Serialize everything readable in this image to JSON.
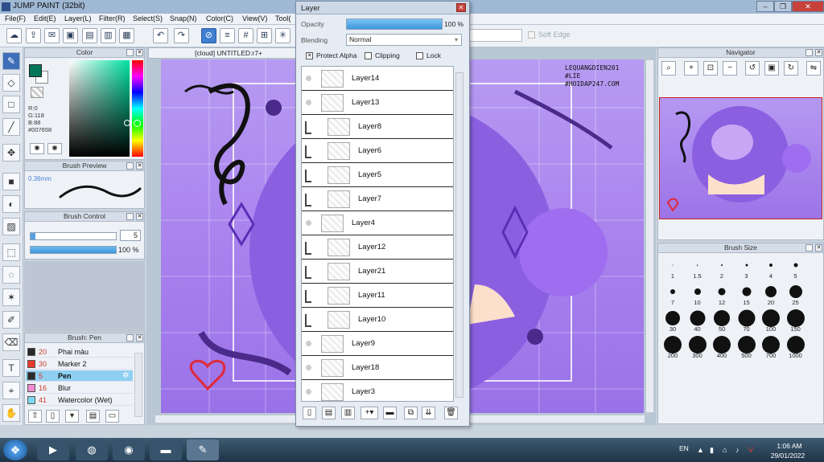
{
  "window": {
    "title": "JUMP PAINT (32bit)",
    "min": "–",
    "max": "❐",
    "close": "✕"
  },
  "menu": [
    "File(F)",
    "Edit(E)",
    "Layer(L)",
    "Filter(R)",
    "Select(S)",
    "Snap(N)",
    "Color(C)",
    "View(V)",
    "Tool("
  ],
  "toolbar": {
    "soft_edge": "Soft Edge"
  },
  "color_panel": {
    "title": "Color",
    "r": "R:0",
    "g": "G:118",
    "b": "B:88",
    "hex": "#007658",
    "main_color": "#007658"
  },
  "brush_preview": {
    "title": "Brush Preview",
    "size": "0.36mm"
  },
  "brush_control": {
    "title": "Brush Control",
    "size": "5",
    "opacity": "100 %"
  },
  "brush_list": {
    "title": "Brush: Pen",
    "items": [
      {
        "num": "20",
        "name": "Phai màu",
        "color": "#2a2a2a"
      },
      {
        "num": "30",
        "name": "Marker 2",
        "color": "#e83a2a"
      },
      {
        "num": "5",
        "name": "Pen",
        "color": "#2a2a2a"
      },
      {
        "num": "16",
        "name": "Blur",
        "color": "#f28ad0"
      },
      {
        "num": "41",
        "name": "Watercolor (Wet)",
        "color": "#7cd8f0"
      }
    ]
  },
  "document": {
    "tab": "[cloud] UNTITLED:r7+",
    "watermark_1": "LEQUANGDIEN201",
    "watermark_2": "#LIE",
    "watermark_3": "#HOIDAP247.COM"
  },
  "layer_panel": {
    "title": "Layer",
    "opacity_label": "Opacity",
    "opacity": "100 %",
    "blending_label": "Blending",
    "blending": "Normal",
    "protect_alpha": "Protect Alpha",
    "clipping": "Clipping",
    "lock": "Lock",
    "layers": [
      {
        "name": "Layer14",
        "clip": false
      },
      {
        "name": "Layer13",
        "clip": false
      },
      {
        "name": "Layer8",
        "clip": true
      },
      {
        "name": "Layer6",
        "clip": true
      },
      {
        "name": "Layer5",
        "clip": true
      },
      {
        "name": "Layer7",
        "clip": true
      },
      {
        "name": "Layer4",
        "clip": false
      },
      {
        "name": "Layer12",
        "clip": true
      },
      {
        "name": "Layer21",
        "clip": true
      },
      {
        "name": "Layer11",
        "clip": true
      },
      {
        "name": "Layer10",
        "clip": true
      },
      {
        "name": "Layer9",
        "clip": false
      },
      {
        "name": "Layer18",
        "clip": false
      },
      {
        "name": "Layer3",
        "clip": false
      }
    ]
  },
  "navigator": {
    "title": "Navigator"
  },
  "brush_size_panel": {
    "title": "Brush Size",
    "sizes": [
      "1",
      "1.5",
      "2",
      "3",
      "4",
      "5",
      "7",
      "10",
      "12",
      "15",
      "20",
      "25",
      "30",
      "40",
      "50",
      "70",
      "100",
      "150",
      "200",
      "300",
      "400",
      "500",
      "700",
      "1000"
    ]
  },
  "taskbar": {
    "lang": "EN",
    "time": "1:06 AM",
    "date": "29/01/2022"
  }
}
